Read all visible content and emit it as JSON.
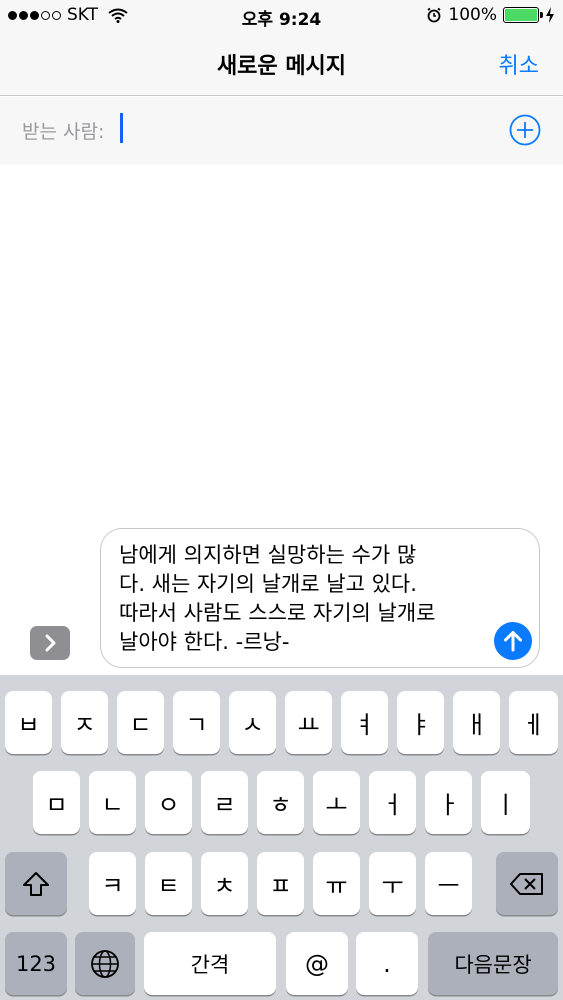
{
  "status_bar": {
    "carrier": "SKT",
    "time": "오후 9:24",
    "battery": "100%",
    "battery_level": 1.0,
    "icons": [
      "signal-dots-icon",
      "wifi-icon",
      "alarm-icon",
      "battery-icon",
      "charging-bolt-icon"
    ]
  },
  "nav": {
    "title": "새로운 메시지",
    "cancel_label": "취소"
  },
  "recipient": {
    "label": "받는 사람:",
    "value": "",
    "add_icon": "plus-circle-icon"
  },
  "composer": {
    "text": "남에게 의지하면 실망하는 수가 많\n다. 새는 자기의 날개로 날고 있다.\n따라서 사람도 스스로 자기의 날개로\n날아야 한다. -르낭-",
    "send_icon": "arrow-up-icon",
    "expand_icon": "chevron-right-icon"
  },
  "colors": {
    "accent": "#0a7bff",
    "keyboard_bg": "#d1d4d9",
    "key_bg": "#ffffff",
    "key_dark": "#abb0ba"
  },
  "keyboard": {
    "row1": [
      "ㅂ",
      "ㅈ",
      "ㄷ",
      "ㄱ",
      "ㅅ",
      "ㅛ",
      "ㅕ",
      "ㅑ",
      "ㅐ",
      "ㅔ"
    ],
    "row2": [
      "ㅁ",
      "ㄴ",
      "ㅇ",
      "ㄹ",
      "ㅎ",
      "ㅗ",
      "ㅓ",
      "ㅏ",
      "ㅣ"
    ],
    "row3": [
      "ㅋ",
      "ㅌ",
      "ㅊ",
      "ㅍ",
      "ㅠ",
      "ㅜ",
      "ㅡ"
    ],
    "shift_icon": "shift-icon",
    "delete_icon": "backspace-icon",
    "numbers_label": "123",
    "globe_icon": "globe-icon",
    "space_label": "간격",
    "at_label": "@",
    "period_label": ".",
    "return_label": "다음문장"
  }
}
